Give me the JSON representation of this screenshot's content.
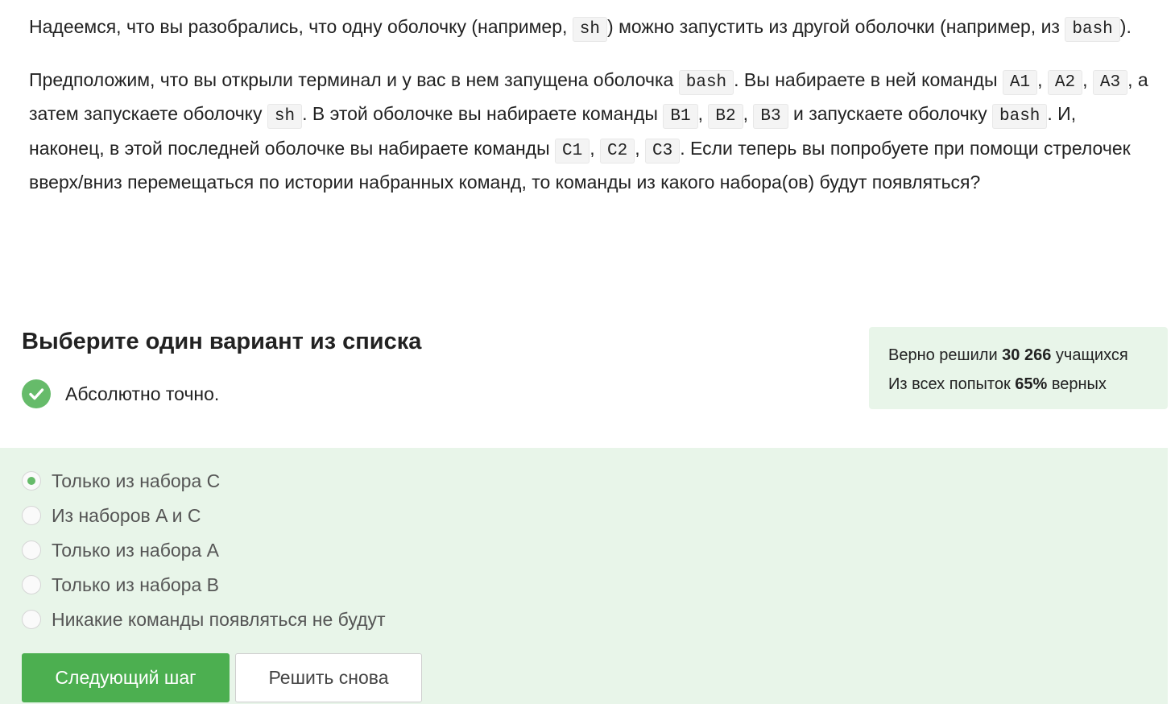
{
  "question": {
    "p1": [
      "Надеемся, что вы разобрались, что одну оболочку (например, ",
      "sh",
      ") можно запустить из другой оболочки (например, из ",
      "bash",
      ")."
    ],
    "p2": [
      "Предположим, что вы открыли терминал и у вас в нем запущена оболочка ",
      "bash",
      ". Вы набираете в ней команды ",
      "A1",
      ", ",
      "A2",
      ", ",
      "A3",
      ", а затем запускаете оболочку ",
      "sh",
      ". В этой оболочке вы набираете команды ",
      "B1",
      ", ",
      "B2",
      ", ",
      "B3",
      " и запускаете оболочку ",
      "bash",
      ". И, наконец, в этой последней оболочке вы набираете команды ",
      "C1",
      ", ",
      "C2",
      ", ",
      "C3",
      ". Если теперь вы попробуете при помощи стрелочек вверх/вниз перемещаться по истории набранных команд, то команды из какого набора(ов) будут появляться?"
    ]
  },
  "choice": {
    "heading": "Выберите один вариант из списка",
    "result_icon": "check-circle-icon",
    "result_text": "Абсолютно точно."
  },
  "stats": {
    "solved_prefix": "Верно решили ",
    "solved_count": "30 266",
    "solved_suffix": " учащихся",
    "attempts_prefix": "Из всех попыток ",
    "attempts_percent": "65%",
    "attempts_suffix": " верных"
  },
  "options": [
    {
      "label": "Только из набора C",
      "selected": true
    },
    {
      "label": "Из наборов A и C",
      "selected": false
    },
    {
      "label": "Только из набора A",
      "selected": false
    },
    {
      "label": "Только из набора B",
      "selected": false
    },
    {
      "label": "Никакие команды появляться не будут",
      "selected": false
    }
  ],
  "buttons": {
    "next_label": "Следующий шаг",
    "retry_label": "Решить снова"
  },
  "colors": {
    "accent_green": "#4caf50",
    "check_green": "#66bb6a",
    "panel_green": "#e8f5e9"
  }
}
